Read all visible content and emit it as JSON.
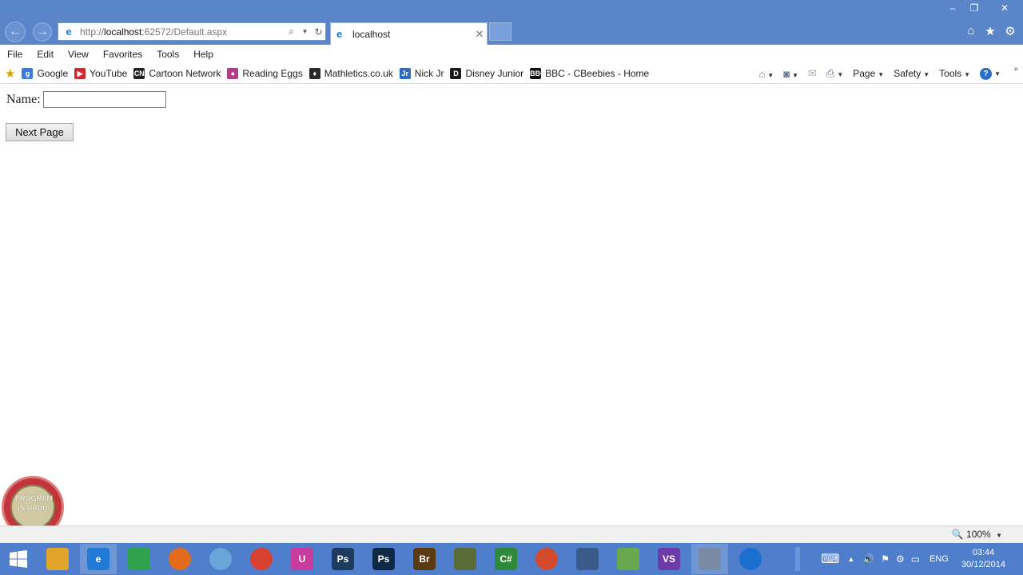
{
  "browser": {
    "url_prefix": "http://",
    "url_host": "localhost",
    "url_rest": ":62572/Default.aspx",
    "tab_title": "localhost",
    "back_icon": "back-arrow-icon",
    "forward_icon": "forward-arrow-icon",
    "search_icon": "search-icon",
    "refresh_icon": "refresh-icon"
  },
  "menu": [
    "File",
    "Edit",
    "View",
    "Favorites",
    "Tools",
    "Help"
  ],
  "favorites": [
    {
      "label": "Google",
      "color": "#3a7be0",
      "glyph": "g"
    },
    {
      "label": "YouTube",
      "color": "#d4262c",
      "glyph": "▶"
    },
    {
      "label": "Cartoon Network",
      "color": "#222222",
      "glyph": "CN"
    },
    {
      "label": "Reading Eggs",
      "color": "#b43c8c",
      "glyph": "●"
    },
    {
      "label": "Mathletics.co.uk",
      "color": "#2b2b2b",
      "glyph": "♦"
    },
    {
      "label": "Nick Jr",
      "color": "#2a6dc8",
      "glyph": "Jr"
    },
    {
      "label": "Disney Junior",
      "color": "#1a1a1a",
      "glyph": "D"
    },
    {
      "label": "BBC - CBeebies - Home",
      "color": "#111111",
      "glyph": "BBC"
    }
  ],
  "commands": {
    "page": "Page",
    "safety": "Safety",
    "tools": "Tools"
  },
  "form": {
    "name_label": "Name:",
    "name_value": "",
    "next_button": "Next Page"
  },
  "logo_text": "PROGRAM IN URDU",
  "status": {
    "zoom": "100%"
  },
  "taskbar": {
    "apps": [
      {
        "name": "file-explorer",
        "label": "",
        "color": "#e0a52a"
      },
      {
        "name": "internet-explorer",
        "label": "e",
        "color": "#1f7bd6"
      },
      {
        "name": "store",
        "label": "",
        "color": "#2ea24d"
      },
      {
        "name": "firefox",
        "label": "",
        "color": "#e36b1c"
      },
      {
        "name": "safari",
        "label": "",
        "color": "#6aa5d9"
      },
      {
        "name": "chrome",
        "label": "",
        "color": "#d8402f"
      },
      {
        "name": "app-purple",
        "label": "U",
        "color": "#c83ca0"
      },
      {
        "name": "photoshop-1",
        "label": "Ps",
        "color": "#1d3a5f"
      },
      {
        "name": "photoshop-2",
        "label": "Ps",
        "color": "#0f2845"
      },
      {
        "name": "bridge",
        "label": "Br",
        "color": "#5a3a12"
      },
      {
        "name": "app-green-box",
        "label": "",
        "color": "#596c3a"
      },
      {
        "name": "csharp",
        "label": "C#",
        "color": "#2e8a3a"
      },
      {
        "name": "app-orange",
        "label": "",
        "color": "#d24a2a"
      },
      {
        "name": "app-doc",
        "label": "",
        "color": "#3a5a8a"
      },
      {
        "name": "app-notepad",
        "label": "",
        "color": "#6aa84f"
      },
      {
        "name": "visual-studio",
        "label": "VS",
        "color": "#6d3ba7"
      },
      {
        "name": "tools-app",
        "label": "",
        "color": "#7a8aa5"
      },
      {
        "name": "teamviewer",
        "label": "",
        "color": "#1b6fcf"
      }
    ],
    "language": "ENG",
    "time": "03:44",
    "date": "30/12/2014"
  }
}
